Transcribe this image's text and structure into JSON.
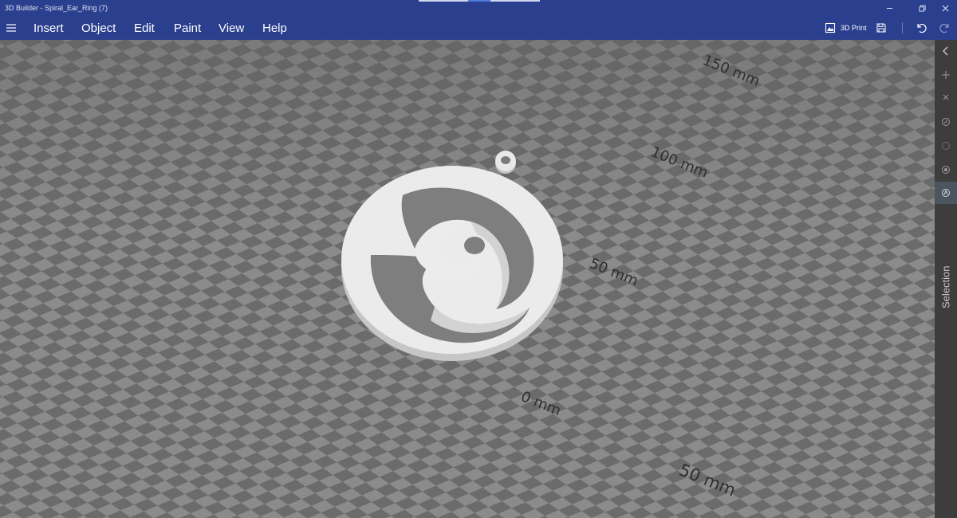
{
  "window": {
    "title": "3D Builder - Spiral_Ear_Ring (7)",
    "colors": {
      "titlebar": "#2b3f8f",
      "floor_light": "#8c8c8c",
      "floor_dark": "#6a6a6a",
      "panel": "#3d3d3d"
    }
  },
  "menu": {
    "items": [
      "Insert",
      "Object",
      "Edit",
      "Paint",
      "View",
      "Help"
    ],
    "print_label": "3D Print"
  },
  "viewport": {
    "scale_labels": [
      "150 mm",
      "100 mm",
      "50 mm",
      "0 mm",
      "50 mm"
    ],
    "object_name": "Spiral_Ear_Ring"
  },
  "right_panel": {
    "selection_label": "Selection",
    "icons": [
      "collapse-icon",
      "move-icon",
      "rotate-icon",
      "scale-icon",
      "circle-icon",
      "drop-icon",
      "selection-mode-icon"
    ]
  }
}
